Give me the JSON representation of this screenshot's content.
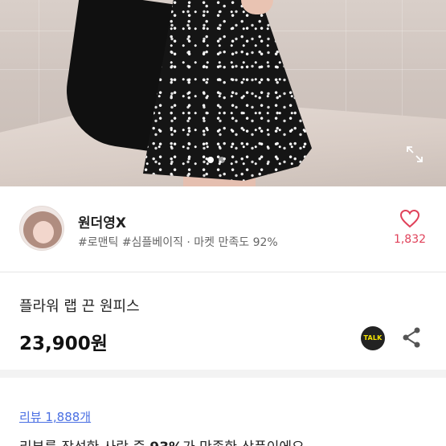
{
  "photo": {
    "expand_icon": "expand-icon",
    "carousel_dots": 2,
    "active_dot": 0
  },
  "seller": {
    "name": "원더영X",
    "tags": "#로맨틱 #심플베이직 · 마켓 만족도 92%",
    "like_icon": "heart-icon",
    "like_count": "1,832"
  },
  "product": {
    "title": "플라워 랩 끈 원피스",
    "price": "23,900원",
    "talk_label": "TALK",
    "share_icon": "share-icon"
  },
  "reviews": {
    "link": "리뷰 1,888개",
    "summary_before": "리뷰를 작성한 사람 중 ",
    "summary_percent": "93%",
    "summary_after": "가 만족한 상품이에요"
  },
  "colors": {
    "accent_heart": "#e0425a",
    "link_blue": "#4a6fe3",
    "talk_yellow": "#f7e600"
  }
}
